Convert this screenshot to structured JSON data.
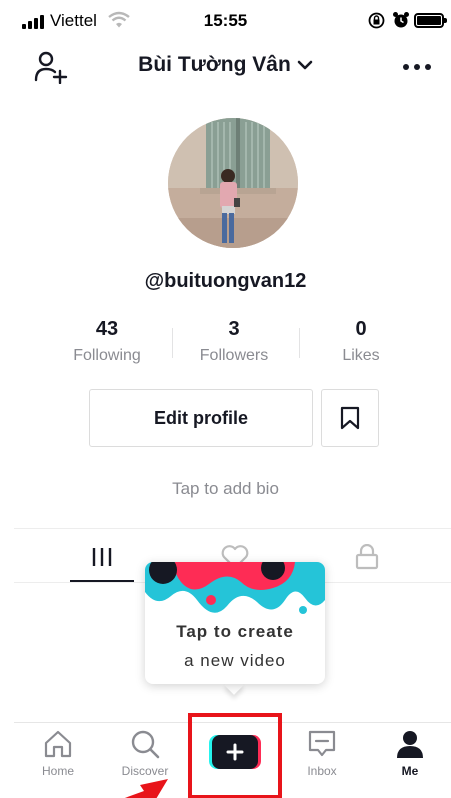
{
  "status_bar": {
    "carrier": "Viettel",
    "time": "15:55",
    "icons": [
      "signal-icon",
      "wifi-icon",
      "rotation-lock-icon",
      "alarm-icon",
      "battery-icon"
    ]
  },
  "header": {
    "username": "Bùi Tường Vân",
    "icons": [
      "add-user-icon",
      "chevron-down-icon",
      "more-icon"
    ]
  },
  "profile": {
    "handle": "@buituongvan12",
    "stats": [
      {
        "value": "43",
        "label": "Following"
      },
      {
        "value": "3",
        "label": "Followers"
      },
      {
        "value": "0",
        "label": "Likes"
      }
    ],
    "edit_label": "Edit profile",
    "bio_placeholder": "Tap to add bio"
  },
  "content_tabs": {
    "icons": [
      "videos-grid-icon",
      "liked-heart-icon",
      "private-lock-icon"
    ],
    "active_index": 0
  },
  "tooltip": {
    "title": "Tap to create",
    "subtitle": "a new video"
  },
  "bottom_nav": {
    "items": [
      {
        "label": "Home",
        "icon": "home-icon"
      },
      {
        "label": "Discover",
        "icon": "search-icon"
      },
      {
        "label": "",
        "icon": "create-plus-icon"
      },
      {
        "label": "Inbox",
        "icon": "inbox-icon"
      },
      {
        "label": "Me",
        "icon": "profile-icon"
      }
    ],
    "active": "Me"
  },
  "colors": {
    "text": "#161823",
    "muted": "#8a8b91",
    "highlight": "#e8141a",
    "tiktok_cyan": "#25f4ee",
    "tiktok_red": "#fe2c55"
  }
}
